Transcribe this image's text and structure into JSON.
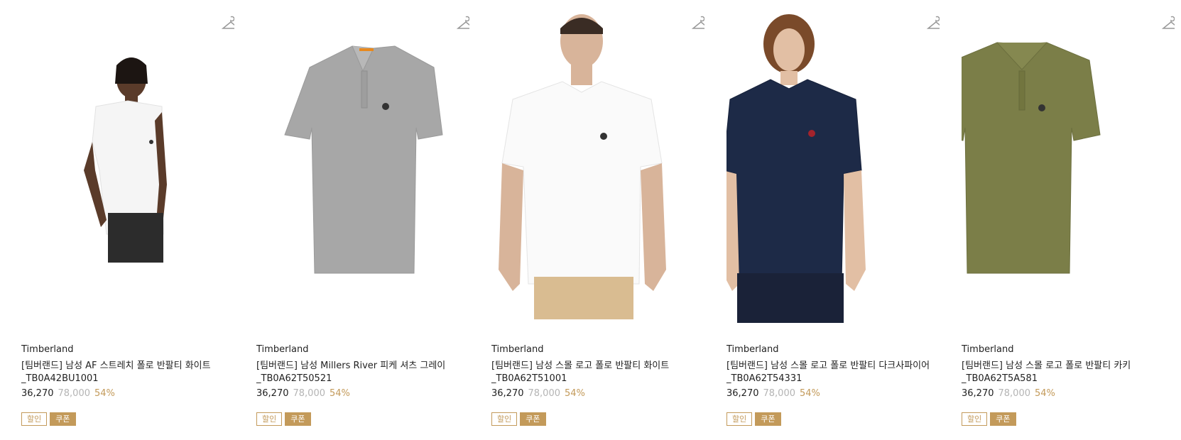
{
  "accent_color": "#c39a5a",
  "products": [
    {
      "image_icon": "white-polo-model-photo",
      "brand": "Timberland",
      "name_line1": "[팀버랜드] 남성 AF 스트레치 폴로 반팔티 화이트",
      "name_line2": "_TB0A42BU1001",
      "sale_price": "36,270",
      "original_price": "78,000",
      "discount": "54%",
      "tag_discount": "할인",
      "tag_coupon": "쿠폰"
    },
    {
      "image_icon": "grey-polo-flat-photo",
      "brand": "Timberland",
      "name_line1": "[팀버랜드] 남성 Millers River 피케 셔츠 그레이",
      "name_line2": "_TB0A62T50521",
      "sale_price": "36,270",
      "original_price": "78,000",
      "discount": "54%",
      "tag_discount": "할인",
      "tag_coupon": "쿠폰"
    },
    {
      "image_icon": "white-polo-model-photo",
      "brand": "Timberland",
      "name_line1": "[팀버랜드] 남성 스몰 로고 폴로 반팔티 화이트",
      "name_line2": "_TB0A62T51001",
      "sale_price": "36,270",
      "original_price": "78,000",
      "discount": "54%",
      "tag_discount": "할인",
      "tag_coupon": "쿠폰"
    },
    {
      "image_icon": "navy-polo-model-photo",
      "brand": "Timberland",
      "name_line1": "[팀버랜드] 남성 스몰 로고 폴로 반팔티 다크사파이어",
      "name_line2": "_TB0A62T54331",
      "sale_price": "36,270",
      "original_price": "78,000",
      "discount": "54%",
      "tag_discount": "할인",
      "tag_coupon": "쿠폰"
    },
    {
      "image_icon": "khaki-polo-flat-photo",
      "brand": "Timberland",
      "name_line1": "[팀버랜드] 남성 스몰 로고 폴로 반팔티 카키",
      "name_line2": "_TB0A62T5A581",
      "sale_price": "36,270",
      "original_price": "78,000",
      "discount": "54%",
      "tag_discount": "할인",
      "tag_coupon": "쿠폰"
    }
  ]
}
